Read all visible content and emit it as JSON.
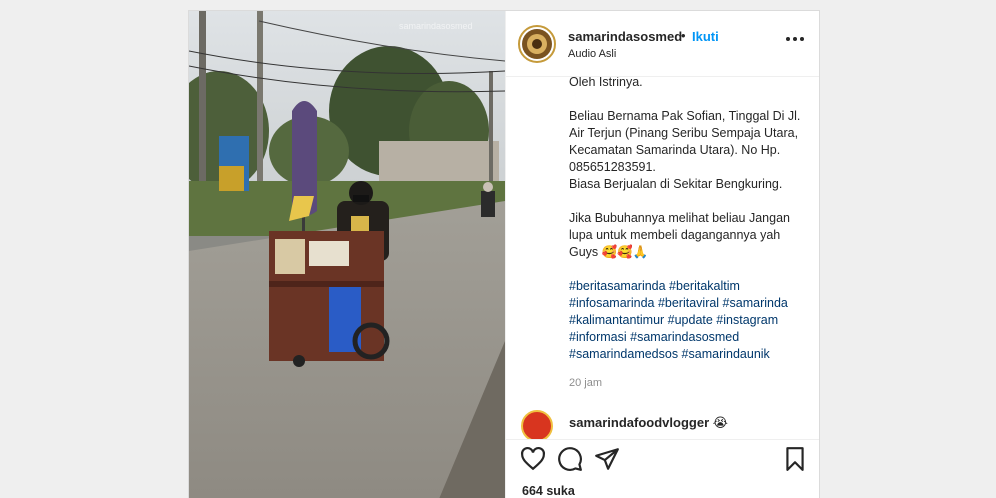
{
  "post": {
    "username": "samarindasosmed",
    "separator": "•",
    "follow_label": "Ikuti",
    "audio_label": "Audio Asli",
    "caption_lines": [
      "Oleh Istrinya.",
      "",
      "Beliau Bernama Pak Sofian, Tinggal Di Jl.",
      "Air Terjun (Pinang Seribu Sempaja Utara,",
      "Kecamatan Samarinda Utara). No Hp.",
      "085651283591.",
      "Biasa Berjualan di Sekitar Bengkuring.",
      "",
      "Jika Bubuhannya melihat beliau Jangan",
      "lupa untuk membeli dagangannya yah",
      "Guys 🥰🥰🙏"
    ],
    "hashtag_lines": [
      "#beritasamarinda #beritakaltim",
      "#infosamarinda #beritaviral #samarinda",
      "#kalimantantimur #update #instagram",
      "#informasi #samarindasosmed",
      "#samarindamedsos #samarindaunik"
    ],
    "time_ago": "20 jam",
    "comment_username": "samarindafoodvlogger 😭",
    "likes": "664 suka",
    "icons": [
      "heart-icon",
      "comment-icon",
      "share-icon",
      "bookmark-icon",
      "more-options-icon"
    ],
    "colors": {
      "follow": "#0095f6",
      "hashtag": "#00376b",
      "muted": "#8e8e8e",
      "avatar_ring": "#c59a3a"
    }
  }
}
